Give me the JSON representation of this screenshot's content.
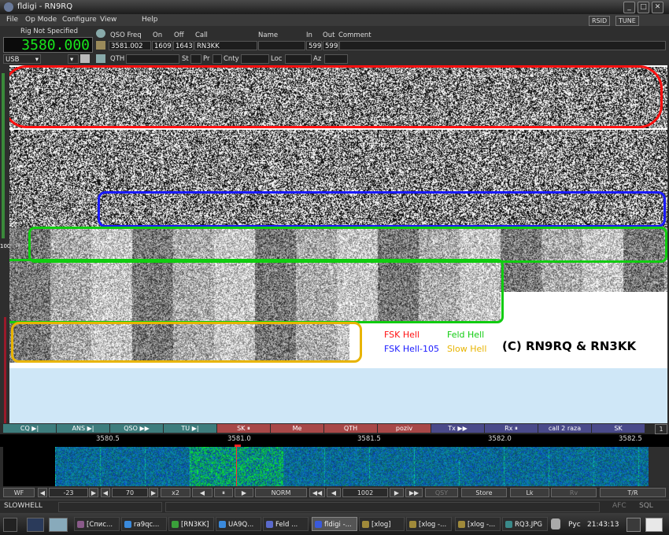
{
  "window": {
    "title": "fldigi - RN9RQ"
  },
  "menu": {
    "items": [
      "File",
      "Op Mode",
      "Configure",
      "View",
      "Help"
    ],
    "rsid": "RSID",
    "tune": "TUNE"
  },
  "rig": {
    "name": "Rig Not Specified",
    "frequency": "3580.000",
    "mode": "USB"
  },
  "qso": {
    "headers": {
      "freq": "QSO Freq",
      "on": "On",
      "off": "Off",
      "call": "Call",
      "name": "Name",
      "in": "In",
      "out": "Out",
      "comment": "Comment"
    },
    "values": {
      "freq": "3581.002",
      "on": "1609",
      "off": "1643",
      "call": "RN3KK",
      "name": "",
      "in": "599",
      "out": "599",
      "comment": ""
    },
    "row2_labels": {
      "qth": "QTH",
      "st": "St",
      "pr": "Pr",
      "cnty": "Cnty",
      "loc": "Loc",
      "az": "Az"
    },
    "side_marker": "100"
  },
  "annotations": {
    "fsk_hell": "FSK Hell",
    "feld_hell": "Feld Hell",
    "fsk_hell_105": "FSK Hell-105",
    "slow_hell": "Slow Hell",
    "credit": "(C) RN9RQ & RN3KK",
    "colors": {
      "fsk_hell": "#ff1010",
      "feld_hell": "#10cc10",
      "fsk_hell_105": "#1a1aff",
      "slow_hell": "#e8b400"
    }
  },
  "macros": [
    {
      "label": "CQ ▶|",
      "color": "#3d7d7d"
    },
    {
      "label": "ANS ▶|",
      "color": "#3d7d7d"
    },
    {
      "label": "QSO ▶▶",
      "color": "#3d7d7d"
    },
    {
      "label": "TU ▶|",
      "color": "#3d7d7d"
    },
    {
      "label": "SK ⏸",
      "color": "#a84848"
    },
    {
      "label": "Me",
      "color": "#a84848"
    },
    {
      "label": "QTH",
      "color": "#a84848"
    },
    {
      "label": "poziv",
      "color": "#a84848"
    },
    {
      "label": "Tx ▶▶",
      "color": "#4a4a8a"
    },
    {
      "label": "Rx ⏸",
      "color": "#4a4a8a"
    },
    {
      "label": "call 2 raza",
      "color": "#4a4a8a"
    },
    {
      "label": "SK",
      "color": "#4a4a8a"
    }
  ],
  "macro_page": "1",
  "scale": {
    "ticks": [
      "3580.5",
      "3581.0",
      "3581.5",
      "3582.0",
      "3582.5"
    ]
  },
  "controls": {
    "wf": "WF",
    "level": "-23",
    "range": "70",
    "zoom": "x2",
    "norm": "NORM",
    "freq": "1002",
    "qsy": "QSY",
    "store": "Store",
    "lk": "Lk",
    "rv": "Rv",
    "tr": "T/R"
  },
  "status": {
    "mode": "SLOWHELL",
    "afc": "AFC",
    "sql": "SQL"
  },
  "taskbar": {
    "items": [
      {
        "label": "[Спис...",
        "icon": "#8a5a8a"
      },
      {
        "label": "ra9qc...",
        "icon": "#3a8adc"
      },
      {
        "label": "[RN3KK]",
        "icon": "#3aa03a"
      },
      {
        "label": "UA9Q...",
        "icon": "#3a8adc"
      },
      {
        "label": "Feld ...",
        "icon": "#5a6acc"
      },
      {
        "label": "fldigi -...",
        "icon": "#3a5adc"
      },
      {
        "label": "[xlog]",
        "icon": "#a08a3a"
      },
      {
        "label": "[xlog -...",
        "icon": "#a08a3a"
      },
      {
        "label": "[xlog -...",
        "icon": "#a08a3a"
      },
      {
        "label": "RQ3.JPG",
        "icon": "#3a8a8a"
      }
    ],
    "lang": "Рус",
    "time": "21:43:13"
  }
}
